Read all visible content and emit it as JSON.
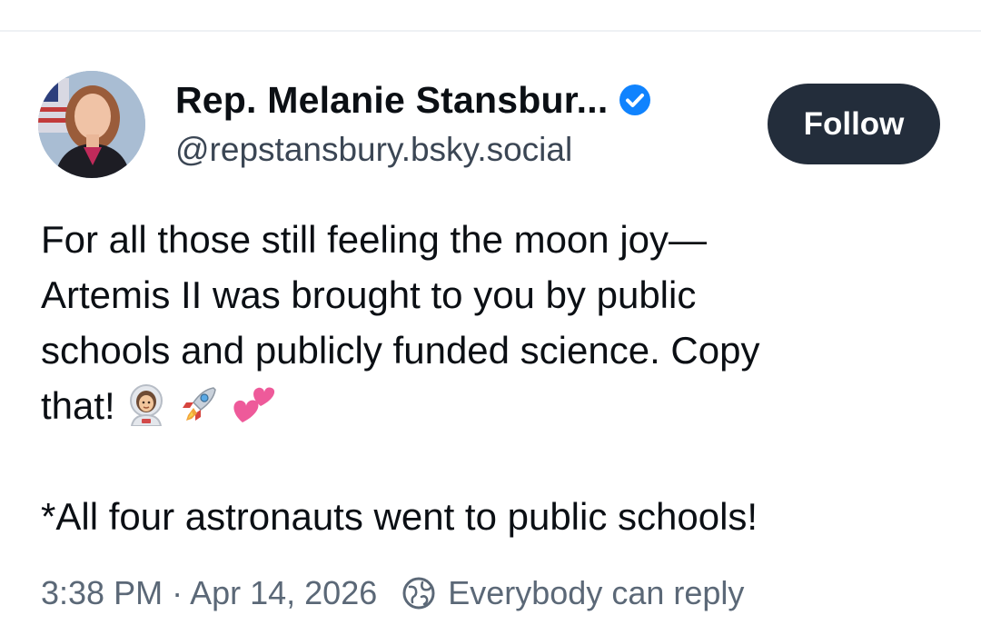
{
  "author": {
    "display_name": "Rep. Melanie Stansbur...",
    "handle": "@repstansbury.bsky.social",
    "avatar_icon": "avatar-photo",
    "verified_icon": "verified-badge-icon",
    "verified_color": "#1083fe"
  },
  "actions": {
    "follow_label": "Follow"
  },
  "post": {
    "lines": [
      "For all those still feeling the moon joy—",
      "Artemis II was brought to you by public",
      "schools and publicly funded science. Copy",
      "that!",
      "*All four astronauts went to public schools!"
    ],
    "emojis": [
      "astronaut-emoji",
      "rocket-emoji",
      "two-hearts-emoji"
    ]
  },
  "footer": {
    "timestamp": "3:38 PM · Apr 14, 2026",
    "reply_setting": "Everybody can reply",
    "reply_icon": "globe-icon"
  }
}
